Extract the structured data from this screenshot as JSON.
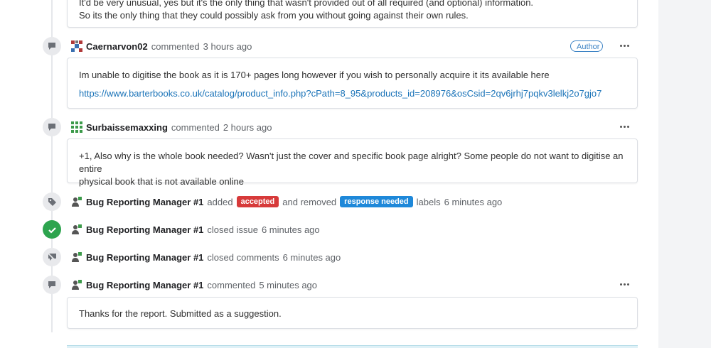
{
  "comment0": {
    "line1": "It'd be very unusual, yes but it's the only thing that wasn't provided out of all required (and optional) information.",
    "line2": "So its the only thing that they could possibly ask from you without going against their own rules."
  },
  "comment1": {
    "user": "Caernarvon02",
    "action": "commented",
    "time": "3 hours ago",
    "badge": "Author",
    "text": "Im unable to digitise the book as it is 170+ pages long however if you wish to personally acquire it its available here",
    "link": "https://www.barterbooks.co.uk/catalog/product_info.php?cPath=8_95&products_id=208976&osCsid=2qv6jrhj7pqkv3lelkj2o7gjo7"
  },
  "comment2": {
    "user": "Surbaissemaxxing",
    "action": "commented",
    "time": "2 hours ago",
    "line1": "+1, Also why is the whole book needed? Wasn't just the cover and specific book page alright? Some people do not want to digitise an entire",
    "line2": "physical book that is not available online"
  },
  "event_labels": {
    "user": "Bug Reporting Manager #1",
    "added": "added",
    "label_accepted": "accepted",
    "removed": "and removed",
    "label_response": "response needed",
    "suffix": "labels",
    "time": "6 minutes ago"
  },
  "event_closed": {
    "user": "Bug Reporting Manager #1",
    "action": "closed issue",
    "time": "6 minutes ago"
  },
  "event_locked": {
    "user": "Bug Reporting Manager #1",
    "action": "closed comments",
    "time": "6 minutes ago"
  },
  "comment3": {
    "user": "Bug Reporting Manager #1",
    "action": "commented",
    "time": "5 minutes ago",
    "text": "Thanks for the report. Submitted as a suggestion."
  },
  "colors": {
    "label_accepted": "#d73a3a",
    "label_response_needed": "#1e88d9",
    "closed_success": "#2da44e",
    "link": "#1a73b8"
  },
  "icons": [
    "comment-icon",
    "tag-icon",
    "check-circle-icon",
    "comment-lock-icon",
    "more-icon"
  ]
}
